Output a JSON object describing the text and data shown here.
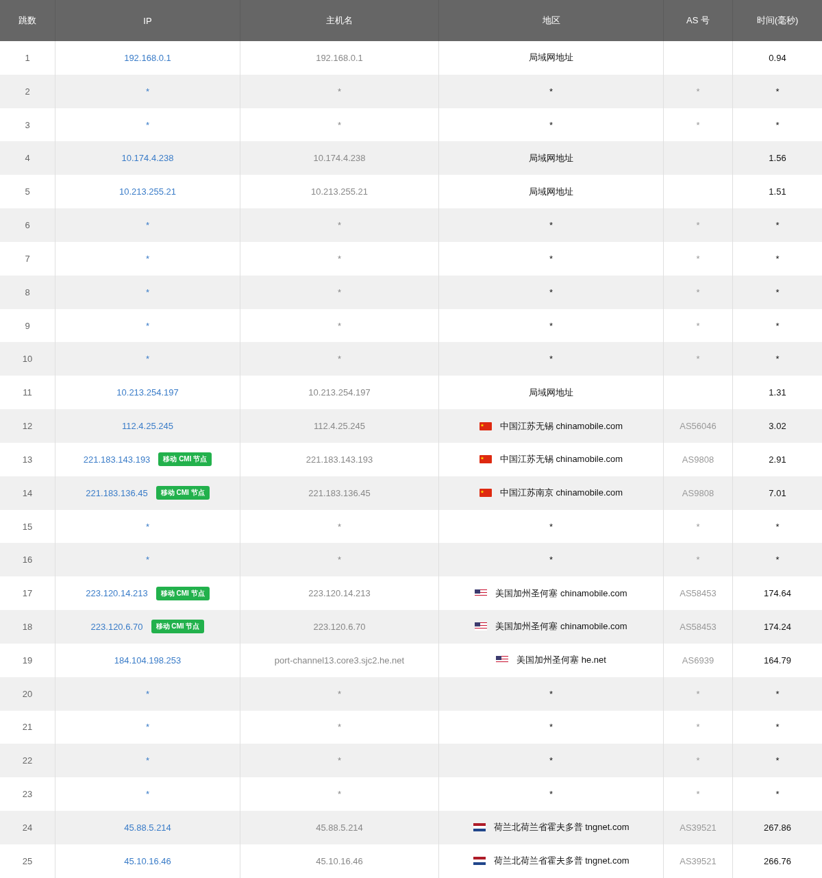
{
  "columns": [
    "跳数",
    "IP",
    "主机名",
    "地区",
    "AS 号",
    "时间(毫秒)"
  ],
  "rows": [
    {
      "hop": "1",
      "ip": "192.168.0.1",
      "host": "192.168.0.1",
      "region": "局域网地址",
      "time": "0.94"
    },
    {
      "hop": "2",
      "ip": "*",
      "host": "*",
      "region": "*",
      "as": "*",
      "time": "*"
    },
    {
      "hop": "3",
      "ip": "*",
      "host": "*",
      "region": "*",
      "as": "*",
      "time": "*"
    },
    {
      "hop": "4",
      "ip": "10.174.4.238",
      "host": "10.174.4.238",
      "region": "局域网地址",
      "time": "1.56"
    },
    {
      "hop": "5",
      "ip": "10.213.255.21",
      "host": "10.213.255.21",
      "region": "局域网地址",
      "time": "1.51"
    },
    {
      "hop": "6",
      "ip": "*",
      "host": "*",
      "region": "*",
      "as": "*",
      "time": "*"
    },
    {
      "hop": "7",
      "ip": "*",
      "host": "*",
      "region": "*",
      "as": "*",
      "time": "*"
    },
    {
      "hop": "8",
      "ip": "*",
      "host": "*",
      "region": "*",
      "as": "*",
      "time": "*"
    },
    {
      "hop": "9",
      "ip": "*",
      "host": "*",
      "region": "*",
      "as": "*",
      "time": "*"
    },
    {
      "hop": "10",
      "ip": "*",
      "host": "*",
      "region": "*",
      "as": "*",
      "time": "*"
    },
    {
      "hop": "11",
      "ip": "10.213.254.197",
      "host": "10.213.254.197",
      "region": "局域网地址",
      "time": "1.31"
    },
    {
      "hop": "12",
      "ip": "112.4.25.245",
      "host": "112.4.25.245",
      "kind": "cn",
      "region": "中国江苏无锡 chinamobile.com",
      "as": "AS56046",
      "time": "3.02"
    },
    {
      "hop": "13",
      "ip": "221.183.143.193",
      "badge": "移动 CMI 节点",
      "host": "221.183.143.193",
      "kind": "cn",
      "region": "中国江苏无锡 chinamobile.com",
      "as": "AS9808",
      "time": "2.91"
    },
    {
      "hop": "14",
      "ip": "221.183.136.45",
      "badge": "移动 CMI 节点",
      "host": "221.183.136.45",
      "kind": "cn",
      "region": "中国江苏南京 chinamobile.com",
      "as": "AS9808",
      "time": "7.01"
    },
    {
      "hop": "15",
      "ip": "*",
      "host": "*",
      "region": "*",
      "as": "*",
      "time": "*"
    },
    {
      "hop": "16",
      "ip": "*",
      "host": "*",
      "region": "*",
      "as": "*",
      "time": "*"
    },
    {
      "hop": "17",
      "ip": "223.120.14.213",
      "badge": "移动 CMI 节点",
      "host": "223.120.14.213",
      "kind": "us",
      "region": "美国加州圣何塞 chinamobile.com",
      "as": "AS58453",
      "time": "174.64"
    },
    {
      "hop": "18",
      "ip": "223.120.6.70",
      "badge": "移动 CMI 节点",
      "host": "223.120.6.70",
      "kind": "us",
      "region": "美国加州圣何塞 chinamobile.com",
      "as": "AS58453",
      "time": "174.24"
    },
    {
      "hop": "19",
      "ip": "184.104.198.253",
      "host": "port-channel13.core3.sjc2.he.net",
      "kind": "us",
      "region": "美国加州圣何塞 he.net",
      "as": "AS6939",
      "time": "164.79"
    },
    {
      "hop": "20",
      "ip": "*",
      "host": "*",
      "region": "*",
      "as": "*",
      "time": "*"
    },
    {
      "hop": "21",
      "ip": "*",
      "host": "*",
      "region": "*",
      "as": "*",
      "time": "*"
    },
    {
      "hop": "22",
      "ip": "*",
      "host": "*",
      "region": "*",
      "as": "*",
      "time": "*"
    },
    {
      "hop": "23",
      "ip": "*",
      "host": "*",
      "region": "*",
      "as": "*",
      "time": "*"
    },
    {
      "hop": "24",
      "ip": "45.88.5.214",
      "host": "45.88.5.214",
      "kind": "nl",
      "region": "荷兰北荷兰省霍夫多普 tngnet.com",
      "as": "AS39521",
      "time": "267.86"
    },
    {
      "hop": "25",
      "ip": "45.10.16.46",
      "host": "45.10.16.46",
      "kind": "nl",
      "region": "荷兰北荷兰省霍夫多普 tngnet.com",
      "as": "AS39521",
      "time": "266.76"
    }
  ]
}
